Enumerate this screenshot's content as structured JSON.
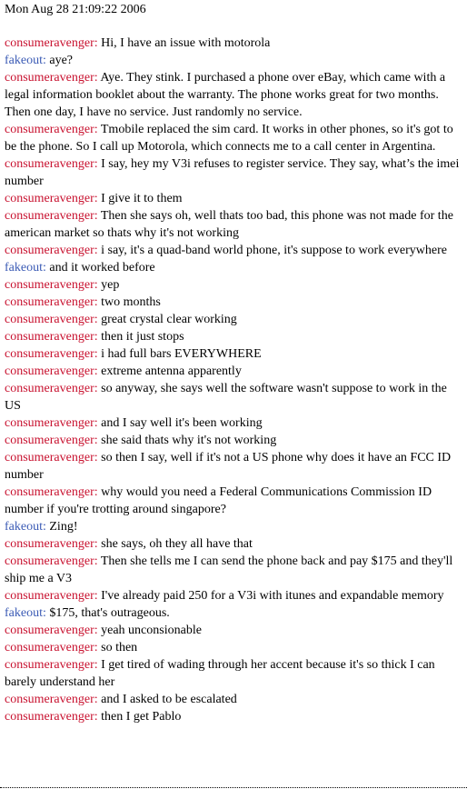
{
  "header": {
    "timestamp": "Mon Aug 28 21:09:22 2006"
  },
  "users": {
    "consumeravenger": {
      "name": "consumeravenger",
      "color": "#c8102e"
    },
    "fakeout": {
      "name": "fakeout",
      "color": "#3b5bb5"
    }
  },
  "messages": [
    {
      "user": "consumeravenger",
      "text": "Hi, I have an issue with motorola"
    },
    {
      "user": "fakeout",
      "text": "aye?"
    },
    {
      "user": "consumeravenger",
      "text": "Aye. They stink. I purchased a phone over eBay, which came with a legal information booklet about the warranty. The phone works great for two months. Then one day, I have no service. Just randomly no service."
    },
    {
      "user": "consumeravenger",
      "text": "Tmobile replaced the sim card. It works in other phones, so it's got to be the phone. So I call up Motorola, which connects me to a call center in Argentina."
    },
    {
      "user": "consumeravenger",
      "text": "I say, hey my V3i refuses to register service. They say, what’s the imei number"
    },
    {
      "user": "consumeravenger",
      "text": "I give it to them"
    },
    {
      "user": "consumeravenger",
      "text": "Then she says oh, well thats too bad, this phone was not made for the american market so thats why it's not working"
    },
    {
      "user": "consumeravenger",
      "text": "i say, it's a quad-band world phone, it's suppose to work everywhere"
    },
    {
      "user": "fakeout",
      "text": "and it worked before"
    },
    {
      "user": "consumeravenger",
      "text": "yep"
    },
    {
      "user": "consumeravenger",
      "text": "two months"
    },
    {
      "user": "consumeravenger",
      "text": "great crystal clear working"
    },
    {
      "user": "consumeravenger",
      "text": "then it just stops"
    },
    {
      "user": "consumeravenger",
      "text": "i had full bars EVERYWHERE"
    },
    {
      "user": "consumeravenger",
      "text": "extreme antenna apparently"
    },
    {
      "user": "consumeravenger",
      "text": "so anyway, she says well the software wasn't suppose to work in the US"
    },
    {
      "user": "consumeravenger",
      "text": "and I say well it's been working"
    },
    {
      "user": "consumeravenger",
      "text": "she said thats why it's not working"
    },
    {
      "user": "consumeravenger",
      "text": "so then I say, well if it's not a US phone why does it have an FCC ID number"
    },
    {
      "user": "consumeravenger",
      "text": "why would you need a Federal Communications Commission ID number if you're trotting around singapore?"
    },
    {
      "user": "fakeout",
      "text": "Zing!"
    },
    {
      "user": "consumeravenger",
      "text": "she says, oh they all have that"
    },
    {
      "user": "consumeravenger",
      "text": "Then she tells me I can send the phone back and pay $175 and they'll ship me a V3"
    },
    {
      "user": "consumeravenger",
      "text": "I've already paid 250 for a V3i with itunes and expandable memory"
    },
    {
      "user": "fakeout",
      "text": "$175, that's outrageous."
    },
    {
      "user": "consumeravenger",
      "text": "yeah unconsionable"
    },
    {
      "user": "consumeravenger",
      "text": "so then"
    },
    {
      "user": "consumeravenger",
      "text": "I get tired of wading through her accent because it's so thick I can barely understand her"
    },
    {
      "user": "consumeravenger",
      "text": "and I asked to be escalated"
    },
    {
      "user": "consumeravenger",
      "text": "then I get Pablo"
    }
  ]
}
